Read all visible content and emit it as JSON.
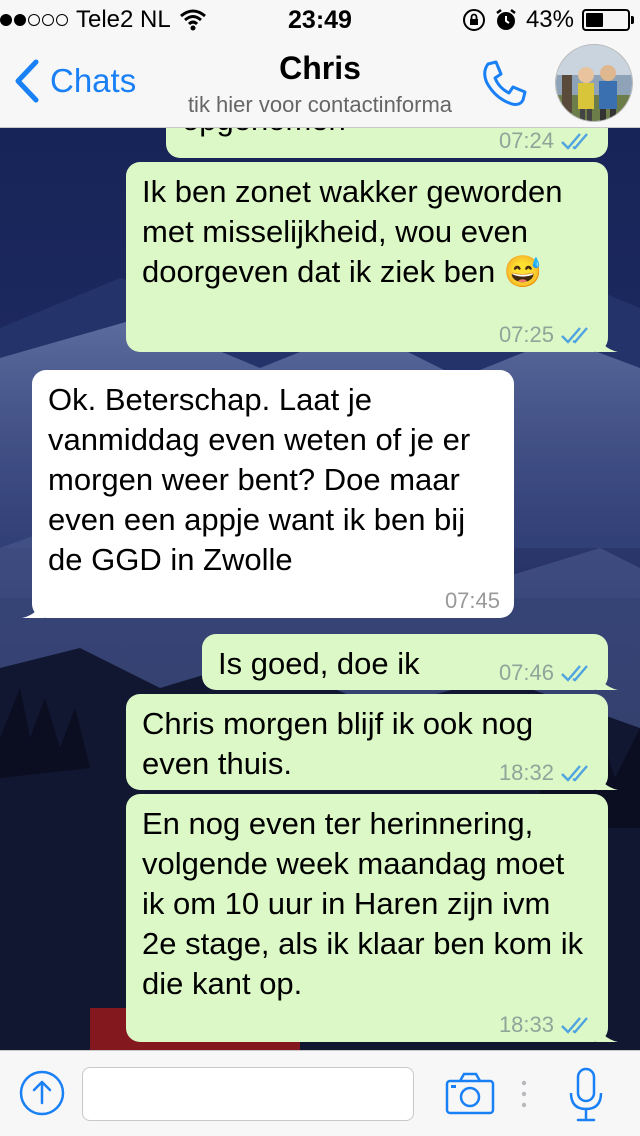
{
  "status_bar": {
    "carrier": "Tele2 NL",
    "time": "23:49",
    "battery_percent_label": "43%",
    "battery_level": 0.43,
    "signal_bars_filled": 2,
    "signal_bars_total": 5
  },
  "nav": {
    "back_label": "Chats",
    "title": "Chris",
    "subtitle": "tik hier voor contactinforma"
  },
  "messages": [
    {
      "direction": "out",
      "text": "opgenomen",
      "time": "07:24",
      "read": true
    },
    {
      "direction": "out",
      "text": "Ik ben zonet wakker geworden met misselijkheid, wou even doorgeven dat ik ziek ben 😅",
      "time": "07:25",
      "read": true
    },
    {
      "direction": "in",
      "text": "Ok. Beterschap. Laat je vanmiddag even weten of je er morgen weer bent? Doe maar even een appje want ik ben bij de GGD in Zwolle",
      "time": "07:45"
    },
    {
      "direction": "out",
      "text": "Is goed, doe ik",
      "time": "07:46",
      "read": true
    },
    {
      "direction": "out",
      "text": "Chris morgen blijf ik ook nog even thuis.",
      "time": "18:32",
      "read": true
    },
    {
      "direction": "out",
      "text": "En nog even ter herinnering, volgende week maandag moet ik om 10 uur in Haren zijn ivm 2e stage, als ik klaar ben kom ik die kant op.",
      "time": "18:33",
      "read": true
    }
  ],
  "input": {
    "value": "",
    "placeholder": ""
  },
  "colors": {
    "accent": "#1a80f5",
    "outgoing_bubble": "#dcf8c6",
    "incoming_bubble": "#ffffff",
    "read_ticks": "#4fa3e0"
  },
  "icons": {
    "back": "chevron-left-icon",
    "call": "phone-icon",
    "attach": "upload-arrow-icon",
    "camera": "camera-icon",
    "mic": "microphone-icon",
    "wifi": "wifi-icon",
    "rotation_lock": "rotation-lock-icon",
    "alarm": "alarm-icon"
  }
}
